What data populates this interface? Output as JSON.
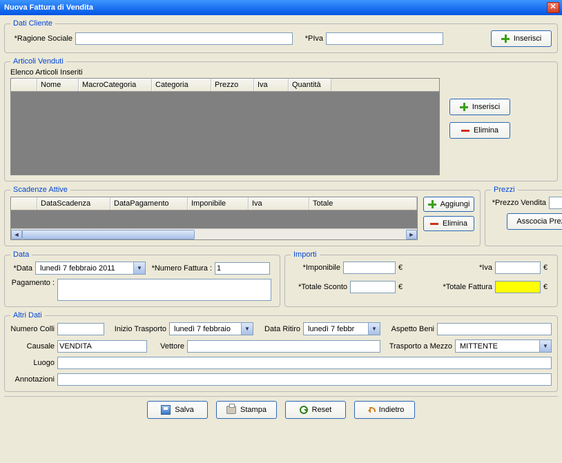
{
  "window": {
    "title": "Nuova Fattura di Vendita"
  },
  "dati_cliente": {
    "legend": "Dati Cliente",
    "ragione_label": "*Ragione Sociale",
    "ragione_value": "",
    "piva_label": "*PIva",
    "piva_value": "",
    "inserisci_label": "Inserisci"
  },
  "articoli": {
    "legend": "Articoli Venduti",
    "sub": "Elenco Articoli Inseriti",
    "cols": [
      "",
      "Nome",
      "MacroCategoria",
      "Categoria",
      "Prezzo",
      "Iva",
      "Quantità"
    ],
    "inserisci_label": "Inserisci",
    "elimina_label": "Elimina"
  },
  "scadenze": {
    "legend": "Scadenze Attive",
    "cols": [
      "",
      "DataScadenza",
      "DataPagamento",
      "Imponibile",
      "Iva",
      "Totale"
    ],
    "aggiungi_label": "Aggiungi",
    "elimina_label": "Elimina"
  },
  "prezzi": {
    "legend": "Prezzi",
    "prezzo_vendita_label": "*Prezzo Vendita",
    "prezzo_vendita_value": "",
    "eur": "€",
    "associa_label": "Asscocia Prezzo"
  },
  "data_box": {
    "legend": "Data",
    "data_label": "*Data",
    "data_value": "lunedì    7  febbraio  2011",
    "numfatt_label": "*Numero Fattura :",
    "numfatt_value": "1",
    "pagamento_label": "Pagamento :",
    "pagamento_value": ""
  },
  "importi": {
    "legend": "Importi",
    "imponibile_label": "*Imponibile",
    "imponibile_value": "",
    "iva_label": "*Iva",
    "iva_value": "",
    "sconto_label": "*Totale Sconto",
    "sconto_value": "",
    "totfatt_label": "*Totale Fattura",
    "totfatt_value": "",
    "eur": "€"
  },
  "altri": {
    "legend": "Altri Dati",
    "numcolli_label": "Numero Colli",
    "numcolli_value": "",
    "inizio_label": "Inizio Trasporto",
    "inizio_value": "lunedì    7  febbraio",
    "ritiro_label": "Data Ritiro",
    "ritiro_value": "lunedì    7  febbr",
    "aspetto_label": "Aspetto Beni",
    "aspetto_value": "",
    "causale_label": "Causale",
    "causale_value": "VENDITA",
    "vettore_label": "Vettore",
    "vettore_value": "",
    "mezzo_label": "Trasporto a Mezzo",
    "mezzo_value": "MITTENTE",
    "luogo_label": "Luogo",
    "luogo_value": "",
    "annot_label": "Annotazioni",
    "annot_value": ""
  },
  "buttons": {
    "salva": "Salva",
    "stampa": "Stampa",
    "reset": "Reset",
    "indietro": "Indietro"
  }
}
